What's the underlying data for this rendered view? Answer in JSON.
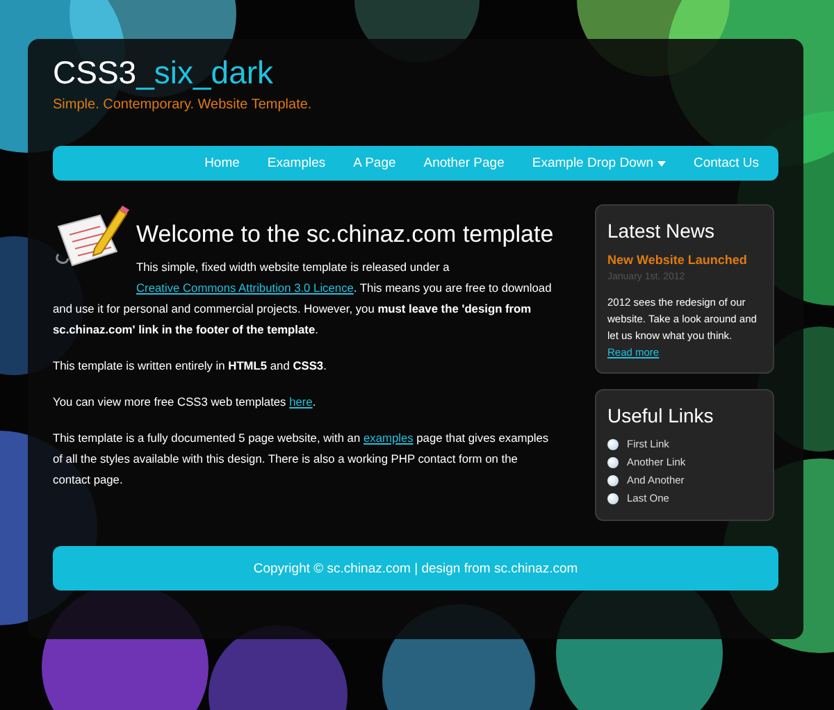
{
  "site": {
    "title_plain": "CSS3",
    "title_accent": "_six_dark",
    "slogan": "Simple. Contemporary. Website Template."
  },
  "nav": [
    {
      "label": "Home",
      "has_dropdown": false
    },
    {
      "label": "Examples",
      "has_dropdown": false
    },
    {
      "label": "A Page",
      "has_dropdown": false
    },
    {
      "label": "Another Page",
      "has_dropdown": false
    },
    {
      "label": "Example Drop Down",
      "has_dropdown": true
    },
    {
      "label": "Contact Us",
      "has_dropdown": false
    }
  ],
  "content": {
    "heading": "Welcome to the sc.chinaz.com template",
    "paragraphs": [
      {
        "parts": [
          {
            "kind": "text",
            "text": "This simple, fixed width website template is released under a "
          },
          {
            "kind": "link",
            "text": "Creative Commons Attribution 3.0 Licence"
          },
          {
            "kind": "text",
            "text": ". This means you are free to download and use it for personal and commercial projects. However, you **must leave the 'design from sc.chinaz.com' link in the footer of the template**."
          }
        ]
      },
      {
        "parts": [
          {
            "kind": "text",
            "text": "This template is written entirely in **HTML5** and **CSS3**."
          }
        ]
      },
      {
        "parts": [
          {
            "kind": "text",
            "text": "You can view more free CSS3 web templates "
          },
          {
            "kind": "link",
            "text": "here"
          },
          {
            "kind": "text",
            "text": "."
          }
        ]
      },
      {
        "parts": [
          {
            "kind": "text",
            "text": "This template is a fully documented 5 page website, with an "
          },
          {
            "kind": "link",
            "text": "examples"
          },
          {
            "kind": "text",
            "text": " page that gives examples of all the styles available with this design. There is also a working PHP contact form on the contact page."
          }
        ]
      }
    ]
  },
  "sidebar": {
    "news": {
      "heading": "Latest News",
      "title": "New Website Launched",
      "date": "January 1st, 2012",
      "body": "2012 sees the redesign of our website. Take a look around and let us know what you think.",
      "link": "Read more"
    },
    "links": {
      "heading": "Useful Links",
      "items": [
        "First Link",
        "Another Link",
        "And Another",
        "Last One"
      ]
    }
  },
  "footer": {
    "text": "Copyright © sc.chinaz.com | design from sc.chinaz.com"
  }
}
